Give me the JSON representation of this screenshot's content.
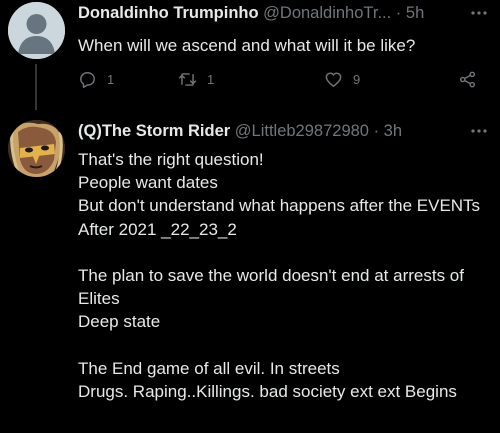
{
  "tweets": [
    {
      "name": "Donaldinho Trumpinho",
      "handle": "@DonaldinhoTr...",
      "separator": "·",
      "time": "5h",
      "text": "When will we ascend and what will it be like?",
      "actions": {
        "reply_count": "1",
        "retweet_count": "1",
        "like_count": "9"
      }
    },
    {
      "name": "(Q)The Storm Rider",
      "handle": "@Littleb29872980",
      "separator": "·",
      "time": "3h",
      "text": "That's the right question!\nPeople want dates\nBut don't understand what happens after the EVENTs\nAfter 2021 _22_23_2\n\nThe plan to save the world doesn't end at arrests of Elites\nDeep state\n\nThe End game of all evil. In streets\nDrugs. Raping..Killings. bad society  ext ext Begins"
    }
  ],
  "colors": {
    "background": "#000000",
    "text": "#e7e9ea",
    "secondary": "#71767b"
  }
}
